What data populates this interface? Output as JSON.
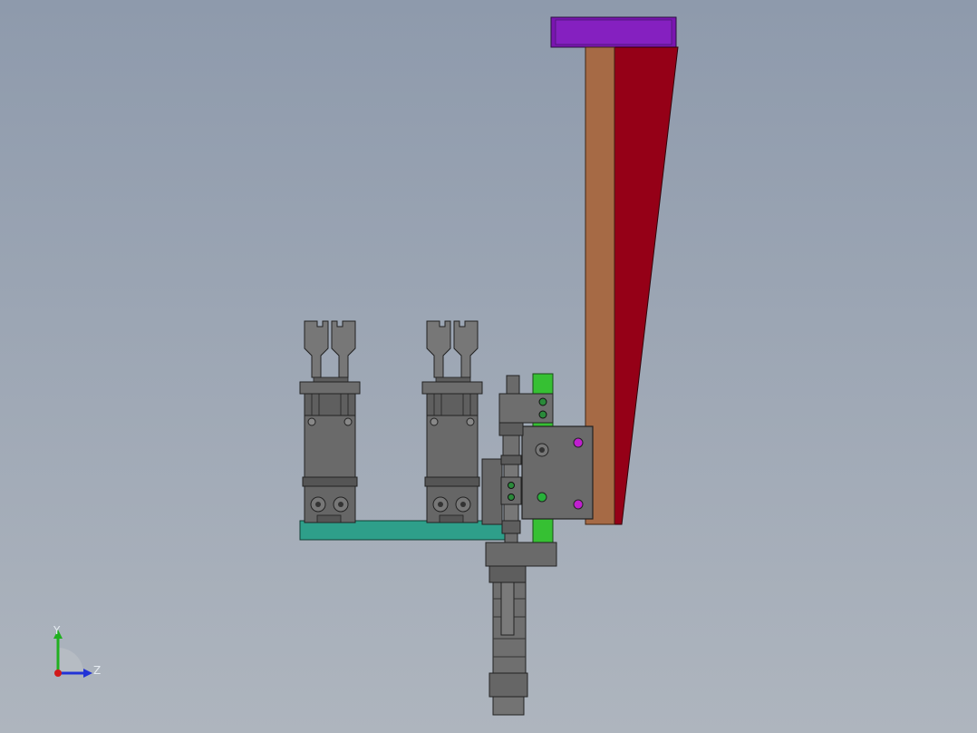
{
  "viewport": {
    "background_top": "#8e9aac",
    "background_bottom": "#aeb5be"
  },
  "model": {
    "bracket_top_color": "#7a15b0",
    "brown_post_color": "#a66a45",
    "red_plate_color": "#950017",
    "base_plate_color": "#2e9f8a",
    "green_rail_color": "#36c033",
    "gripper_body_color": "#6d6d6d",
    "gripper_finger_color": "#777777",
    "mount_plate_color": "#6a6a6a",
    "cylinder_color": "#6f6f6f",
    "screw_magenta": "#c01fcf",
    "screw_green": "#27b13a"
  },
  "triad": {
    "x_label": "",
    "y_label": "Y",
    "z_label": "Z",
    "x_color": "#d11a1a",
    "y_color": "#20b020",
    "z_color": "#2233d6"
  }
}
